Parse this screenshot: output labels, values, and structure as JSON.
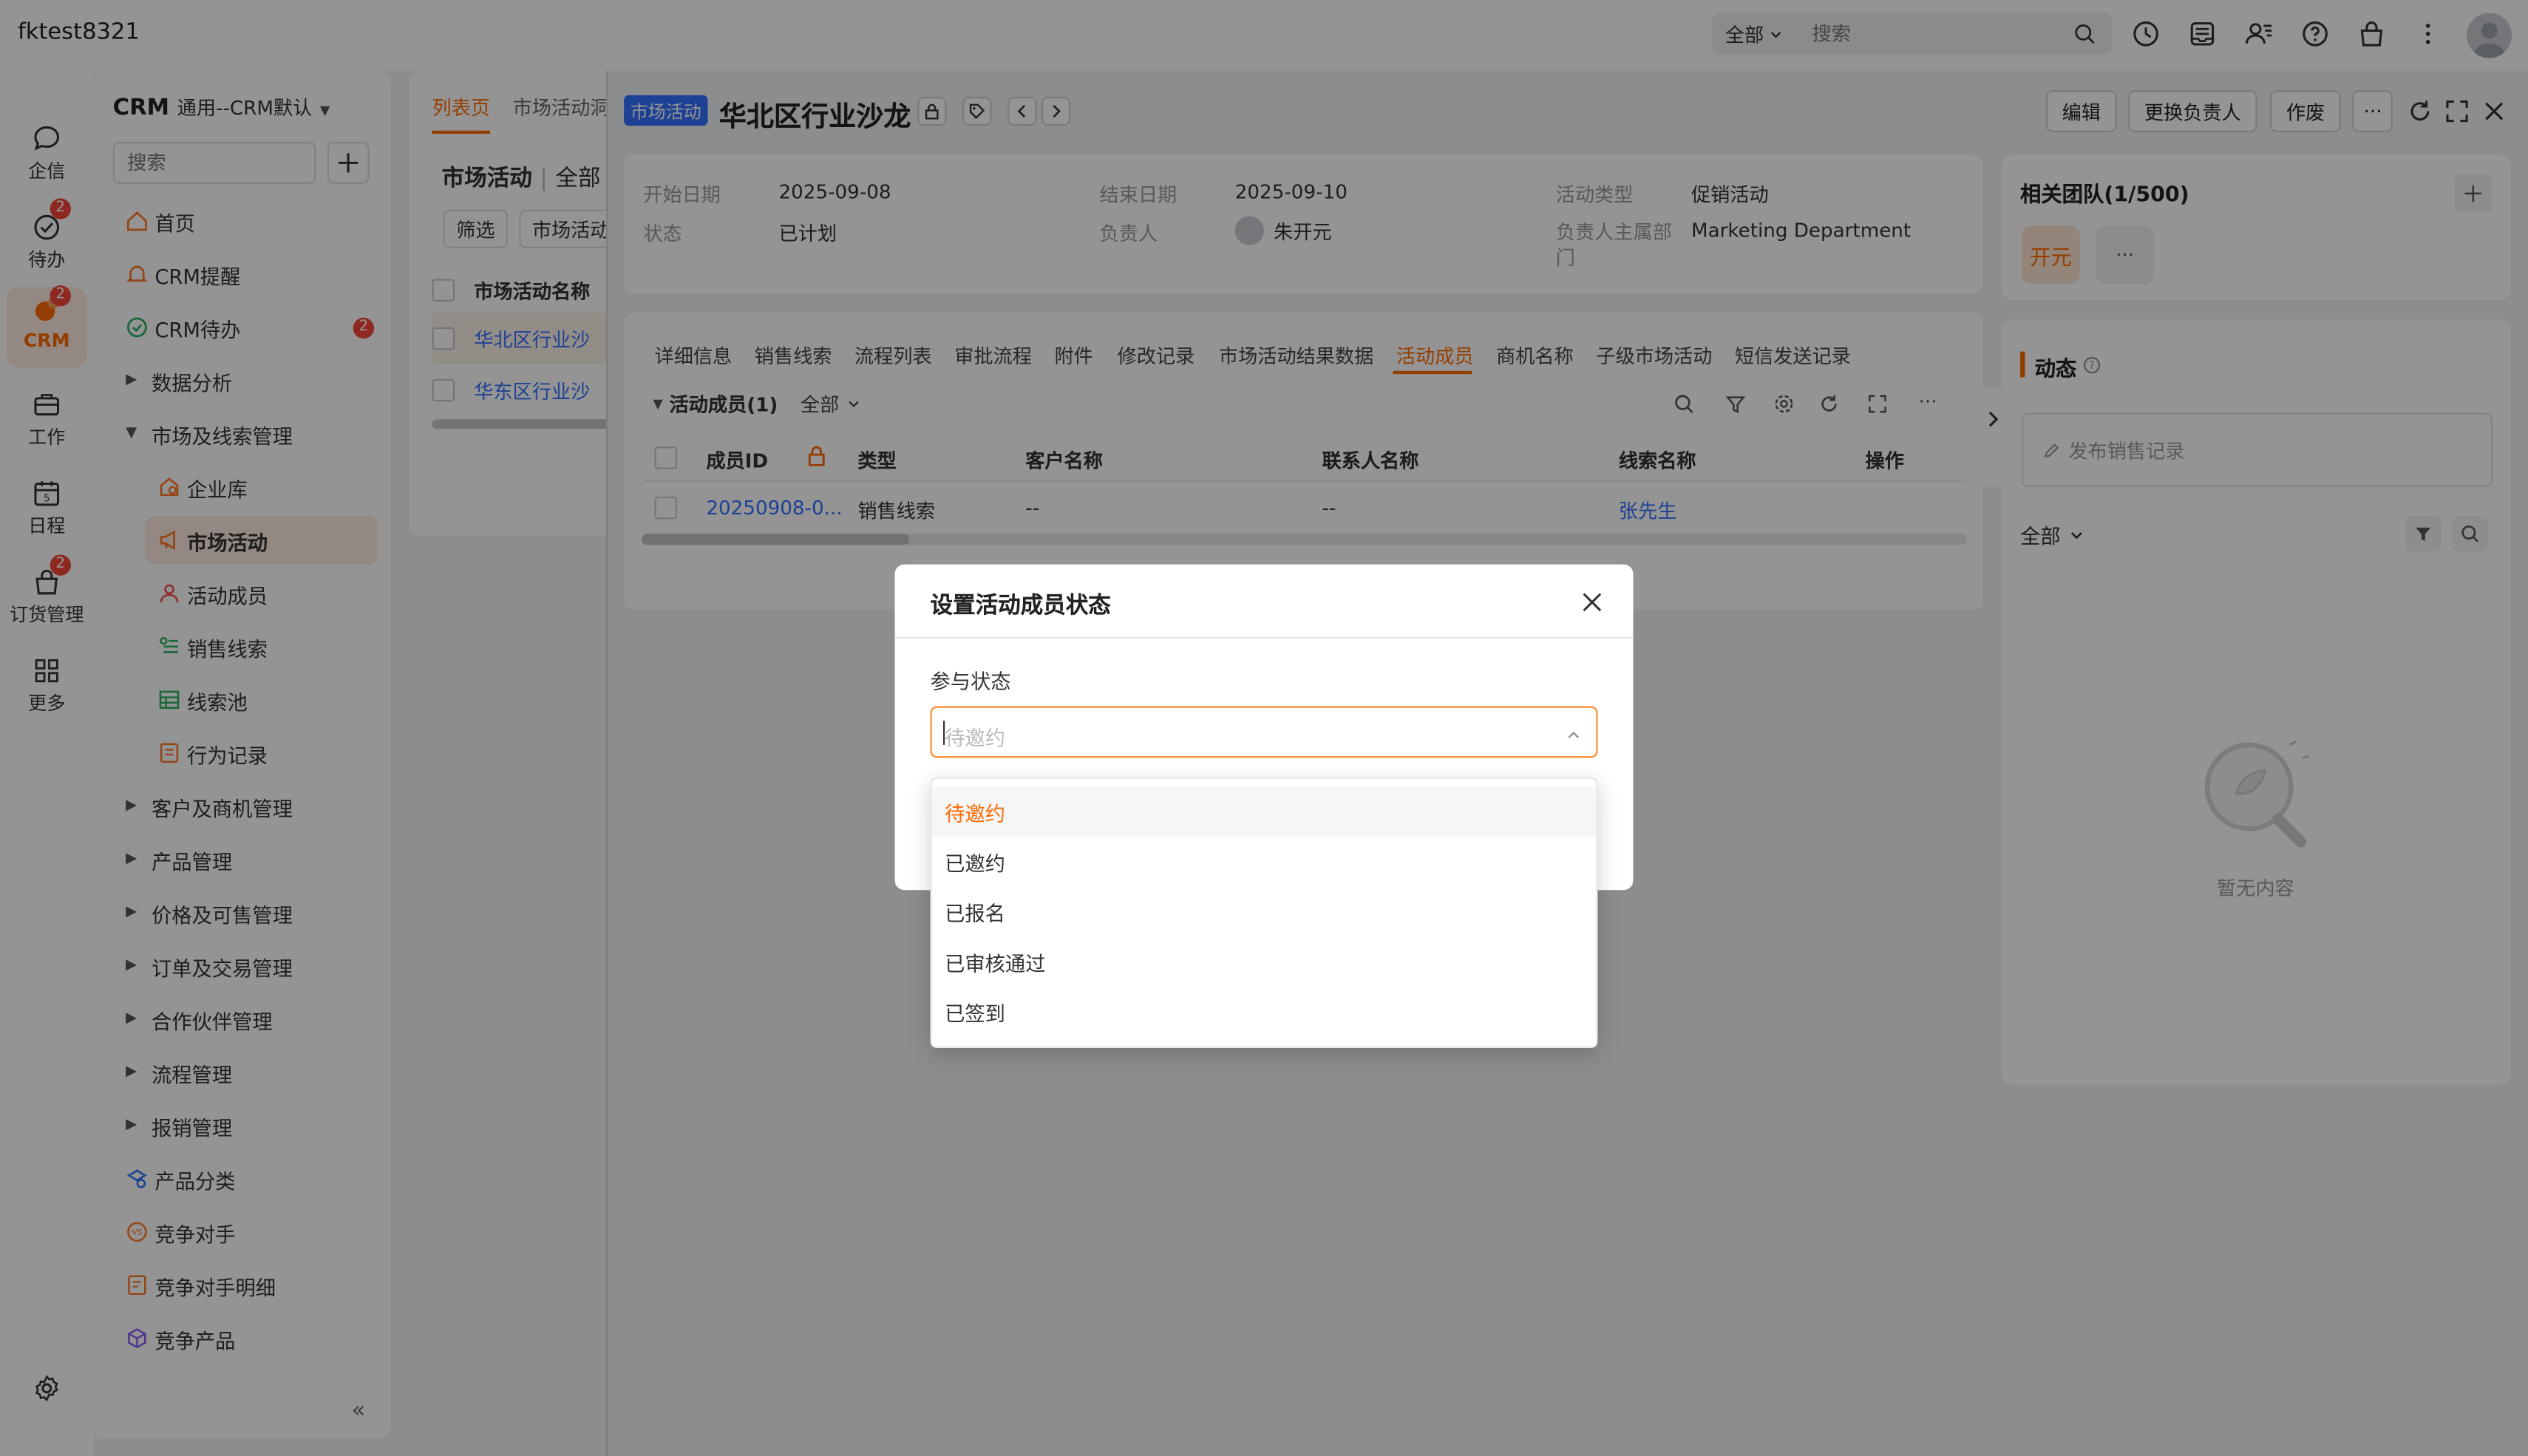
{
  "topbar": {
    "brand": "fktest8321",
    "scope": "全部",
    "search_placeholder": "搜索"
  },
  "rail": [
    {
      "label": "企信",
      "icon": "chat-icon",
      "badge": ""
    },
    {
      "label": "待办",
      "icon": "todo-icon",
      "badge": "2"
    },
    {
      "label": "CRM",
      "icon": "crm-icon",
      "badge": "2"
    },
    {
      "label": "工作",
      "icon": "work-icon",
      "badge": ""
    },
    {
      "label": "日程",
      "icon": "calendar-icon",
      "badge": ""
    },
    {
      "label": "订货管理",
      "icon": "order-icon",
      "badge": "2"
    },
    {
      "label": "更多",
      "icon": "grid-icon",
      "badge": ""
    }
  ],
  "sidebar": {
    "title": "CRM",
    "subtitle": "通用--CRM默认",
    "search_placeholder": "搜索",
    "items": [
      {
        "label": "首页",
        "badge": ""
      },
      {
        "label": "CRM提醒",
        "badge": ""
      },
      {
        "label": "CRM待办",
        "badge": "2"
      },
      {
        "label": "数据分析",
        "badge": ""
      },
      {
        "label": "市场及线索管理",
        "badge": ""
      },
      {
        "label": "企业库",
        "badge": ""
      },
      {
        "label": "市场活动",
        "badge": ""
      },
      {
        "label": "活动成员",
        "badge": ""
      },
      {
        "label": "销售线索",
        "badge": ""
      },
      {
        "label": "线索池",
        "badge": ""
      },
      {
        "label": "行为记录",
        "badge": ""
      },
      {
        "label": "客户及商机管理",
        "badge": ""
      },
      {
        "label": "产品管理",
        "badge": ""
      },
      {
        "label": "价格及可售管理",
        "badge": ""
      },
      {
        "label": "订单及交易管理",
        "badge": ""
      },
      {
        "label": "合作伙伴管理",
        "badge": ""
      },
      {
        "label": "流程管理",
        "badge": ""
      },
      {
        "label": "报销管理",
        "badge": ""
      },
      {
        "label": "产品分类",
        "badge": ""
      },
      {
        "label": "竞争对手",
        "badge": ""
      },
      {
        "label": "竞争对手明细",
        "badge": ""
      },
      {
        "label": "竞争产品",
        "badge": ""
      }
    ]
  },
  "list": {
    "tabs": [
      "列表页",
      "市场活动洞"
    ],
    "title": "市场活动",
    "scope": "全部",
    "filter_btn": "筛选",
    "type_btn": "市场活动",
    "col_header": "市场活动名称",
    "rows": [
      "华北区行业沙",
      "华东区行业沙"
    ]
  },
  "detail": {
    "tag": "市场活动",
    "name": "华北区行业沙龙",
    "buttons": [
      "编辑",
      "更换负责人",
      "作废"
    ],
    "info": [
      {
        "k": "开始日期",
        "v": "2025-09-08"
      },
      {
        "k": "结束日期",
        "v": "2025-09-10"
      },
      {
        "k": "活动类型",
        "v": "促销活动"
      },
      {
        "k": "状态",
        "v": "已计划"
      },
      {
        "k": "负责人",
        "v": "朱开元"
      },
      {
        "k": "负责人主属部门",
        "v": "Marketing Department"
      }
    ],
    "tabs": [
      "详细信息",
      "销售线索",
      "流程列表",
      "审批流程",
      "附件",
      "修改记录",
      "市场活动结果数据",
      "活动成员",
      "商机名称",
      "子级市场活动",
      "短信发送记录"
    ],
    "members": {
      "title": "活动成员(1)",
      "scope": "全部",
      "columns": [
        "成员ID",
        "类型",
        "客户名称",
        "联系人名称",
        "线索名称",
        "操作"
      ],
      "rows": [
        {
          "id": "20250908-0...",
          "type": "销售线索",
          "customer": "--",
          "contact": "--",
          "lead": "张先生"
        }
      ]
    }
  },
  "right": {
    "team_title": "相关团队(1/500)",
    "team_member": "开元",
    "dyn_title": "动态",
    "post_placeholder": "发布销售记录",
    "dyn_scope": "全部",
    "empty_text": "暂无内容"
  },
  "dialog": {
    "title": "设置活动成员状态",
    "field_label": "参与状态",
    "placeholder": "待邀约",
    "options": [
      "待邀约",
      "已邀约",
      "已报名",
      "已审核通过",
      "已签到"
    ],
    "selected": "待邀约"
  },
  "colors": {
    "accent": "#ff6a00",
    "link": "#3370ff",
    "badge": "#f5483b"
  }
}
